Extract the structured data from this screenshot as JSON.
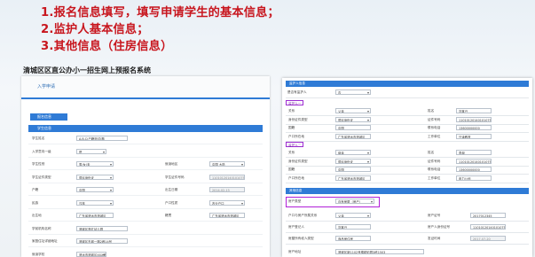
{
  "headings": [
    "1.报名信息填写，填写申请学生的基本信息；",
    "2.监护人基本信息；",
    "3.其他信息（住房信息）"
  ],
  "system_title": "清城区区直公办小一招生网上预报名系统",
  "left": {
    "tab": "入学申请",
    "section_top": "报名信息",
    "section_student": "学生信息",
    "rows": [
      {
        "l1": "学生姓名",
        "v1": "A.B.C(户籍测试)题",
        "t1": "text"
      },
      {
        "l1": "入学意向一级",
        "v1": "是",
        "t1": "dd"
      },
      {
        "l1": "学生性别",
        "v1": "男/女/未",
        "t1": "dd",
        "l2": "就读地区",
        "v2": "中国 大陆",
        "t2": "dd"
      },
      {
        "l1": "学生证件类型",
        "v1": "居民身份证",
        "t1": "dd",
        "l2": "学生证件号码",
        "v2": "110101201401010757",
        "t2": "gray"
      },
      {
        "l1": "户籍",
        "v1": "中国",
        "t1": "dd",
        "l2": "出生日期",
        "v2": "2014-02-13",
        "t2": "gray"
      },
      {
        "l1": "民族",
        "v1": "汉族",
        "t1": "dd",
        "l2": "户口性质",
        "v2": "农业户口",
        "t2": "dd"
      },
      {
        "l1": "出生地",
        "v1": "广东省清远市清城区",
        "t1": "text",
        "l2": "籍贯",
        "v2": "广东省清远市清城区",
        "t2": "text"
      },
      {
        "l1": "学前机构名称",
        "v1": "清城区育红幼儿园",
        "t1": "text"
      },
      {
        "l1": "家庭住址详细地址",
        "v1": "清城区东城一路2巷14号",
        "t1": "text"
      },
      {
        "l1": "就读学校",
        "v1": "清远市清城区XXX学校",
        "t1": "dd"
      }
    ]
  },
  "right": {
    "section_guardian": "监护人信息",
    "guardian_relation_label": "是否有监护人",
    "guardian_relation_value": "否",
    "g1_tag": "监护人一",
    "g2_tag": "监护人二",
    "g1": [
      {
        "l1": "关系",
        "v1": "父亲",
        "l2": "姓名",
        "v2": "刘某兴"
      },
      {
        "l1": "身份证件类型",
        "v1": "居民身份证",
        "l2": "证件号码",
        "v2": "110101201401010757"
      },
      {
        "l1": "国籍",
        "v1": "中国",
        "l2": "联系电话",
        "v2": "13600000000"
      },
      {
        "l1": "户口所在地",
        "v1": "广东省清远市清城区",
        "l2": "工作单位",
        "v2": "只读教育"
      }
    ],
    "g2": [
      {
        "l1": "关系",
        "v1": "母亲",
        "l2": "姓名",
        "v2": "李母"
      },
      {
        "l1": "身份证件类型",
        "v1": "居民身份证",
        "l2": "证件号码",
        "v2": "110101201401010757"
      },
      {
        "l1": "国籍",
        "v1": "中国",
        "l2": "联系电话",
        "v2": "13600000000"
      },
      {
        "l1": "户口所在地",
        "v1": "广东省清远市清城区",
        "l2": "工作单位",
        "v2": "电力公司"
      }
    ],
    "section_other": "其他信息",
    "house_label": "房产类型",
    "house_value": "自有房屋（房产）",
    "other": [
      {
        "l1": "户口与房产所属关系",
        "v1": "父亲",
        "l2": "房产证号",
        "v2": "2017012345"
      },
      {
        "l1": "房产登记人",
        "v1": "刘某兴",
        "l2": "房产人身份证号",
        "v2": "110101201401010757"
      },
      {
        "l1": "房屋所有权人类型",
        "v1": "商品房住房",
        "l2": "发证时间",
        "v2": "2017-07-20"
      }
    ],
    "address_label": "房产地址",
    "address_value": "清城区新1102号楼精彩园3栋1503"
  }
}
